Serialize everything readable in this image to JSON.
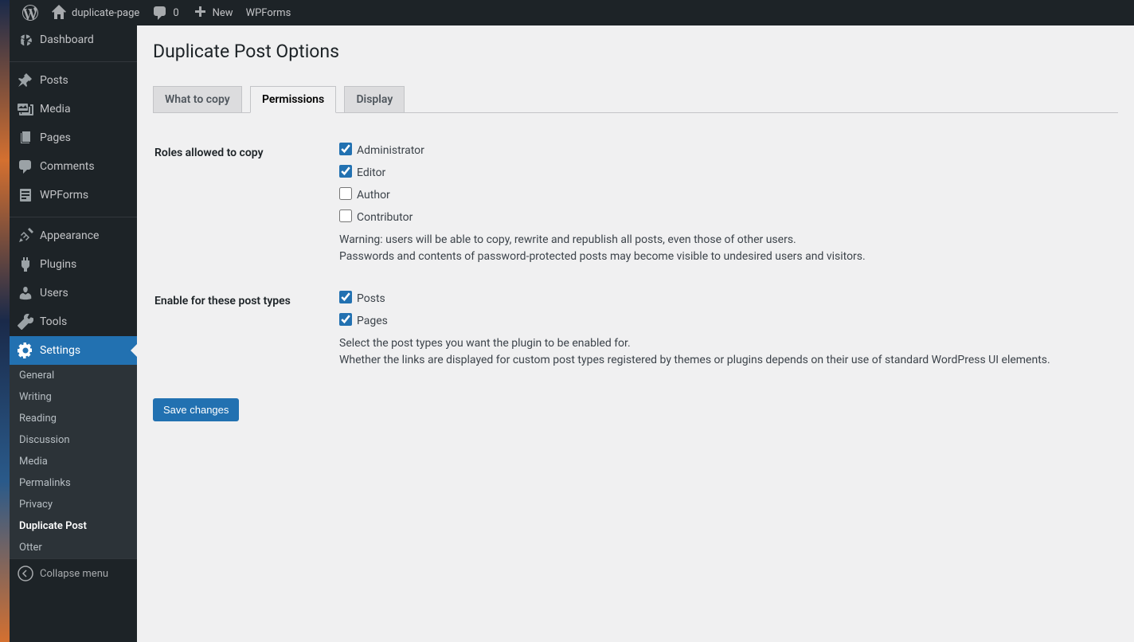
{
  "adminbar": {
    "site_name": "duplicate-page",
    "comments_count": "0",
    "new_label": "New",
    "wpforms_label": "WPForms"
  },
  "menu": {
    "dashboard": "Dashboard",
    "posts": "Posts",
    "media": "Media",
    "pages": "Pages",
    "comments": "Comments",
    "wpforms": "WPForms",
    "appearance": "Appearance",
    "plugins": "Plugins",
    "users": "Users",
    "tools": "Tools",
    "settings": "Settings",
    "collapse": "Collapse menu"
  },
  "submenu": {
    "general": "General",
    "writing": "Writing",
    "reading": "Reading",
    "discussion": "Discussion",
    "media": "Media",
    "permalinks": "Permalinks",
    "privacy": "Privacy",
    "duplicate_post": "Duplicate Post",
    "otter": "Otter"
  },
  "page": {
    "title": "Duplicate Post Options",
    "tabs": {
      "what_to_copy": "What to copy",
      "permissions": "Permissions",
      "display": "Display"
    },
    "roles": {
      "heading": "Roles allowed to copy",
      "items": [
        {
          "label": "Administrator",
          "checked": true
        },
        {
          "label": "Editor",
          "checked": true
        },
        {
          "label": "Author",
          "checked": false
        },
        {
          "label": "Contributor",
          "checked": false
        }
      ],
      "warning_line1": "Warning: users will be able to copy, rewrite and republish all posts, even those of other users.",
      "warning_line2": "Passwords and contents of password-protected posts may become visible to undesired users and visitors."
    },
    "post_types": {
      "heading": "Enable for these post types",
      "items": [
        {
          "label": "Posts",
          "checked": true
        },
        {
          "label": "Pages",
          "checked": true
        }
      ],
      "desc_line1": "Select the post types you want the plugin to be enabled for.",
      "desc_line2": "Whether the links are displayed for custom post types registered by themes or plugins depends on their use of standard WordPress UI elements."
    },
    "save_button": "Save changes"
  }
}
